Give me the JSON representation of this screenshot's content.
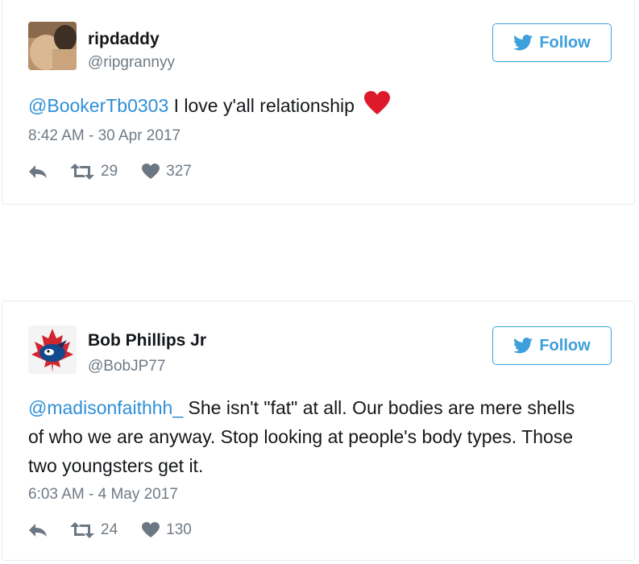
{
  "tweets": [
    {
      "name": "ripdaddy",
      "handle": "@ripgrannyy",
      "follow_label": "Follow",
      "mention": "@BookerTb0303",
      "text": " I love y'all relationship",
      "emoji": "red-heart-emoji",
      "timestamp": "8:42 AM - 30 Apr 2017",
      "retweets": "29",
      "likes": "327"
    },
    {
      "name": "Bob Phillips Jr",
      "handle": "@BobJP77",
      "follow_label": "Follow",
      "mention": "@madisonfaithhh_",
      "text": " She isn't \"fat\" at all. Our bodies are mere shells of who we are anyway. Stop looking at people's body types. Those two youngsters get it.",
      "timestamp": "6:03 AM - 4 May 2017",
      "retweets": "24",
      "likes": "130"
    }
  ],
  "icons": {
    "bird": "twitter-bird-icon",
    "reply": "reply-icon",
    "retweet": "retweet-icon",
    "like": "heart-icon"
  },
  "colors": {
    "accent": "#3d9fdb",
    "mention": "#2f8fd6",
    "muted": "#707b85",
    "heart": "#e0245e"
  }
}
